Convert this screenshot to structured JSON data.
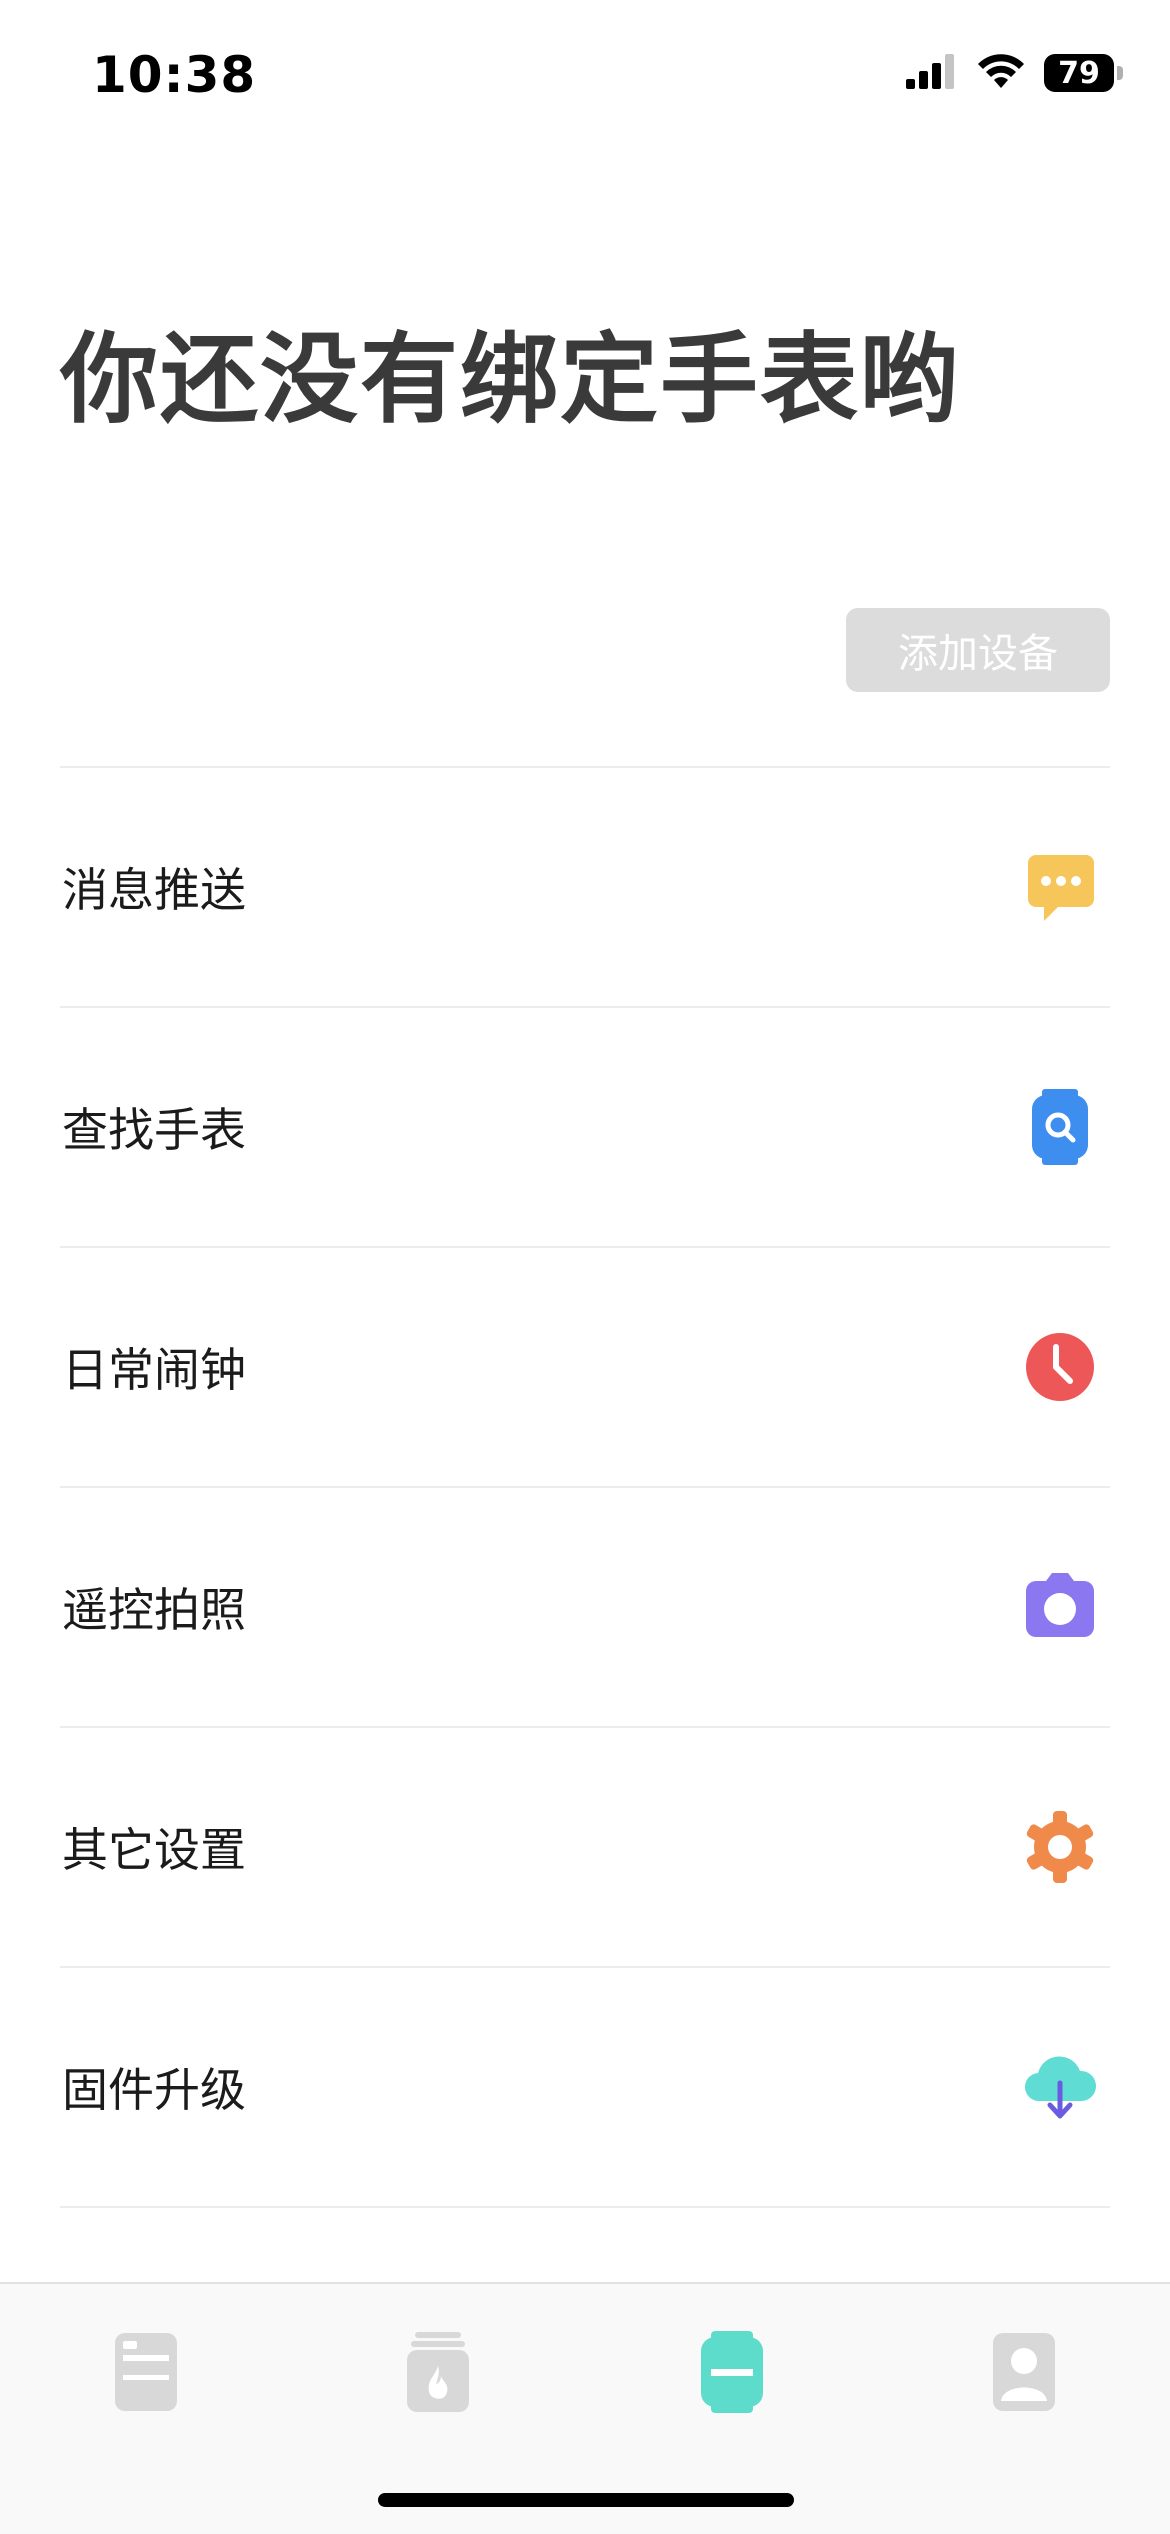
{
  "status_bar": {
    "time": "10:38",
    "battery": "79",
    "signal_icon": "cellular-signal-icon",
    "wifi_icon": "wifi-icon"
  },
  "page": {
    "title": "你还没有绑定手表哟",
    "add_device_label": "添加设备"
  },
  "menu": {
    "items": [
      {
        "label": "消息推送",
        "icon": "message-bubble-icon",
        "color": "#F7C65A"
      },
      {
        "label": "查找手表",
        "icon": "find-watch-icon",
        "color": "#3E8EF0"
      },
      {
        "label": "日常闹钟",
        "icon": "alarm-clock-icon",
        "color": "#EE5757"
      },
      {
        "label": "遥控拍照",
        "icon": "camera-icon",
        "color": "#8B78F0"
      },
      {
        "label": "其它设置",
        "icon": "gear-icon",
        "color": "#F08A4B"
      },
      {
        "label": "固件升级",
        "icon": "cloud-download-icon",
        "color": "#5FDCD3"
      }
    ]
  },
  "tab_bar": {
    "tabs": [
      {
        "icon": "list-card-icon",
        "active": false
      },
      {
        "icon": "fire-jar-icon",
        "active": false
      },
      {
        "icon": "watch-icon",
        "active": true
      },
      {
        "icon": "user-profile-icon",
        "active": false
      }
    ],
    "active_color": "#5EDCCB",
    "inactive_color": "#D8D8D8"
  }
}
